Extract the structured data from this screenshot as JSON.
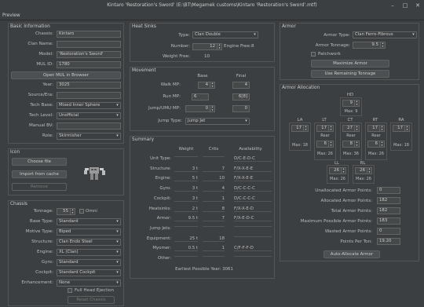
{
  "window": {
    "title": "Kintaro 'Restoration's Sword' (E:\\BT\\Megamek customs\\Kintaro 'Restoration's Sword'.mtf)",
    "minimize": "–",
    "maximize": "□",
    "close": "✕"
  },
  "menu": {
    "preview": "Preview"
  },
  "basic": {
    "title": "Basic Information",
    "chassis_label": "Chassis:",
    "chassis": "Kintaro",
    "clan_label": "Clan Name:",
    "clan": "",
    "model_label": "Model:",
    "model": "'Restoration's Sword'",
    "mul_label": "MUL ID:",
    "mul": "1780",
    "open_mul": "Open MUL in Browser",
    "year_label": "Year:",
    "year": "3025",
    "source_label": "Source/Era:",
    "source": "",
    "techbase_label": "Tech Base:",
    "techbase": "Mixed Inner Sphere",
    "techlevel_label": "Tech Level:",
    "techlevel": "Unofficial",
    "manualbv_label": "Manual BV:",
    "manualbv": "",
    "role_label": "Role:",
    "role": "Skirmisher"
  },
  "icon": {
    "title": "Icon",
    "choose": "Choose file",
    "import": "Import from cache",
    "remove": "Remove"
  },
  "chassis": {
    "title": "Chassis",
    "tonnage_label": "Tonnage:",
    "tonnage": "55",
    "omni": "Omni",
    "basetype_label": "Base Type:",
    "basetype": "Standard",
    "motive_label": "Motive Type:",
    "motive": "Biped",
    "structure_label": "Structure:",
    "structure": "Clan Endo Steel",
    "engine_label": "Engine:",
    "engine": "XL (Clan)",
    "gyro_label": "Gyro:",
    "gyro": "Standard",
    "cockpit_label": "Cockpit:",
    "cockpit": "Standard Cockpit",
    "enh_label": "Enhancement:",
    "enh": "None",
    "fullhead": "Full Head Ejection",
    "reset": "Reset Chassis"
  },
  "heat": {
    "title": "Heat Sinks",
    "type_label": "Type:",
    "type": "Clan Double",
    "number_label": "Number:",
    "number": "12",
    "enginefree_label": "Engine Free:",
    "enginefree": "8",
    "weightfree_label": "Weight Free:",
    "weightfree": "10"
  },
  "movement": {
    "title": "Movement",
    "base": "Base",
    "final": "Final",
    "walk_label": "Walk MP:",
    "walk_base": "4",
    "walk_final": "4",
    "run_label": "Run MP:",
    "run_base": "6",
    "run_final": "6[8]",
    "jump_label": "Jump/UMU MP:",
    "jump_base": "0",
    "jump_final": "0",
    "jumptype_label": "Jump Type:",
    "jumptype": "Jump Jet"
  },
  "summary": {
    "title": "Summary",
    "h_weight": "Weight",
    "h_crits": "Crits",
    "h_avail": "Availability",
    "rows": [
      {
        "label": "Unit Type:",
        "weight": "",
        "crits": "",
        "avail": "D/C-E-D-C"
      },
      {
        "label": "Structure:",
        "weight": "3 t",
        "crits": "7",
        "avail": "F/X-X-E-E"
      },
      {
        "label": "Engine:",
        "weight": "5 t",
        "crits": "10",
        "avail": "F/X-X-E-E"
      },
      {
        "label": "Gyro:",
        "weight": "3 t",
        "crits": "4",
        "avail": "D/C-C-C-C"
      },
      {
        "label": "Cockpit:",
        "weight": "3 t",
        "crits": "1",
        "avail": "D/C-C-C-C"
      },
      {
        "label": "Heatsinks:",
        "weight": "2 t",
        "crits": "8",
        "avail": "F/X-X-E-D"
      },
      {
        "label": "Armor:",
        "weight": "9.5 t",
        "crits": "7",
        "avail": "F/X-E-D-C"
      },
      {
        "label": "Jump Jets:",
        "weight": "",
        "crits": "",
        "avail": ""
      },
      {
        "label": "Equipment:",
        "weight": "25 t",
        "crits": "18",
        "avail": ""
      },
      {
        "label": "Myomer:",
        "weight": "0.5 t",
        "crits": "1",
        "avail": "C/F-F-F-D"
      },
      {
        "label": "Other:",
        "weight": "",
        "crits": "",
        "avail": ""
      }
    ],
    "earliest": "Earliest Possible Year: 3061"
  },
  "armor": {
    "title": "Armor",
    "type_label": "Armor Type:",
    "type": "Clan Ferro-Fibrous",
    "tonnage_label": "Armor Tonnage:",
    "tonnage": "9.5",
    "patchwork": "Patchwork",
    "maximize": "Maximize Armor",
    "remaining": "Use Remaining Tonnage"
  },
  "alloc": {
    "title": "Armor Allocation",
    "hd": {
      "label": "HD",
      "value": "9",
      "max": "Max: 9"
    },
    "la": {
      "label": "LA",
      "value": "17",
      "max": "Max: 18"
    },
    "lt": {
      "label": "LT",
      "value": "17",
      "rear_label": "Rear",
      "rear": "6",
      "max": "Max: 26"
    },
    "ct": {
      "label": "CT",
      "value": "27",
      "rear_label": "Rear",
      "rear": "8",
      "max": "Max: 36"
    },
    "rt": {
      "label": "RT",
      "value": "17",
      "rear_label": "Rear",
      "rear": "6",
      "max": "Max: 26"
    },
    "ra": {
      "label": "RA",
      "value": "17",
      "max": "Max: 18"
    },
    "ll": {
      "label": "LL",
      "value": "26",
      "max": "Max: 26"
    },
    "rl": {
      "label": "RL",
      "value": "26",
      "max": "Max: 26"
    },
    "unallocated_label": "Unallocated Armor Points:",
    "unallocated": "0",
    "allocated_label": "Allocated Armor Points:",
    "allocated": "182",
    "total_label": "Total Armor Points:",
    "total": "182",
    "maxpts_label": "Maximum Possible Armor Points:",
    "maxpts": "183",
    "wasted_label": "Wasted Armor Points:",
    "wasted": "0",
    "perton_label": "Points Per Ton:",
    "perton": "19.20",
    "auto": "Auto-Allocate Armor"
  }
}
